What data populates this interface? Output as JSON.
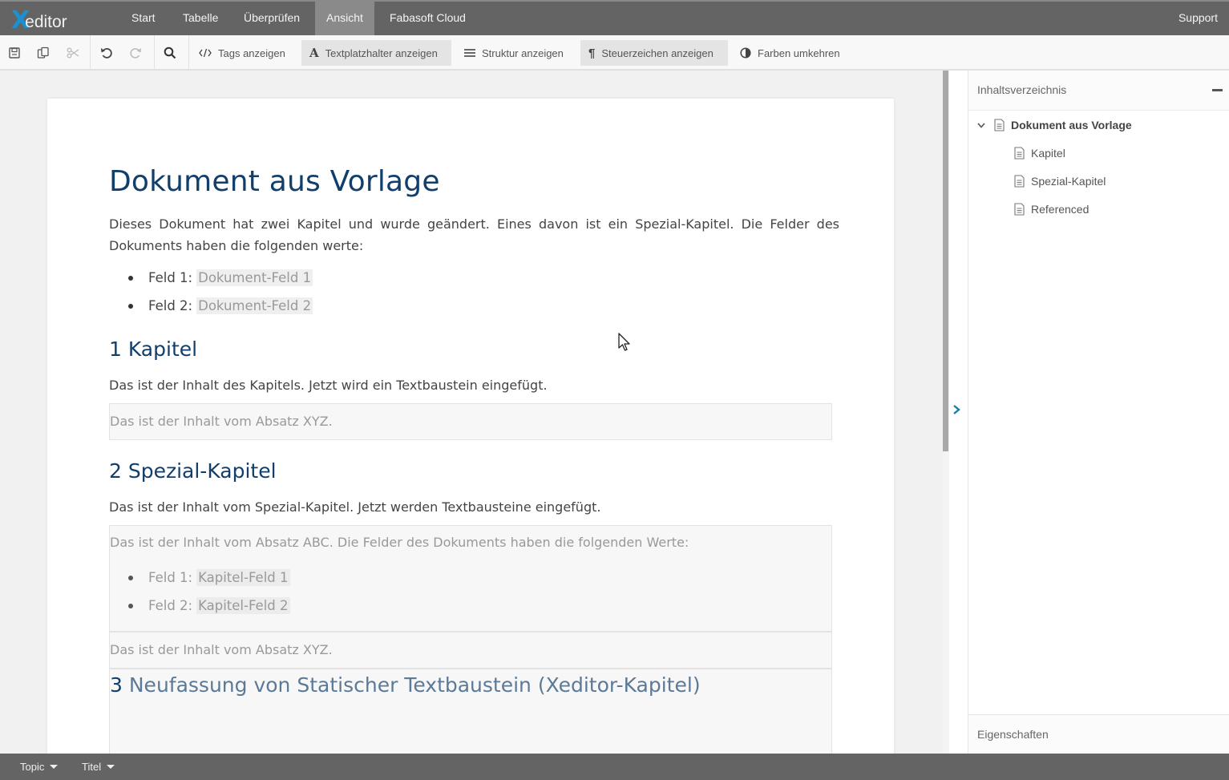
{
  "app": {
    "logo_x": "X",
    "logo_rest": "editor",
    "menu": [
      {
        "label": "Start",
        "active": false
      },
      {
        "label": "Tabelle",
        "active": false
      },
      {
        "label": "Überprüfen",
        "active": false
      },
      {
        "label": "Ansicht",
        "active": true
      },
      {
        "label": "Fabasoft Cloud",
        "active": false
      }
    ],
    "support_label": "Support"
  },
  "toolbar": {
    "icons": [
      "save-icon",
      "copy-icon",
      "cut-icon",
      "undo-icon",
      "redo-icon",
      "search-icon"
    ],
    "buttons": [
      {
        "label": "Tags anzeigen",
        "icon": "code-tags-icon",
        "active": false
      },
      {
        "label": "Textplatzhalter anzeigen",
        "icon": "text-placeholder-icon",
        "active": true
      },
      {
        "label": "Struktur anzeigen",
        "icon": "structure-list-icon",
        "active": false
      },
      {
        "label": "Steuerzeichen anzeigen",
        "icon": "pilcrow-icon",
        "active": true
      },
      {
        "label": "Farben umkehren",
        "icon": "invert-colors-icon",
        "active": false
      }
    ]
  },
  "document": {
    "title": "Dokument aus Vorlage",
    "intro": "Dieses Dokument hat zwei Kapitel und wurde geändert. Eines davon ist ein Spezial-Kapitel. Die Felder des Dokuments haben die folgenden werte:",
    "fields": [
      {
        "label": "Feld 1:",
        "value": "Dokument-Feld 1"
      },
      {
        "label": "Feld 2:",
        "value": "Dokument-Feld 2"
      }
    ],
    "chapter1": {
      "heading": "1 Kapitel",
      "text": "Das ist der Inhalt des Kapitels. Jetzt wird ein Textbaustein eingefügt.",
      "block_text": "Das ist der Inhalt vom Absatz XYZ."
    },
    "chapter2": {
      "heading": "2 Spezial-Kapitel",
      "text": "Das ist der Inhalt vom Spezial-Kapitel. Jetzt werden Textbausteine eingefügt.",
      "block_abc_text": "Das ist der Inhalt vom Absatz ABC. Die Felder des  Dokuments haben die folgenden Werte:",
      "block_fields": [
        {
          "label": "Feld 1:",
          "value": "Kapitel-Feld 1"
        },
        {
          "label": "Feld 2:",
          "value": "Kapitel-Feld 2"
        }
      ],
      "block_xyz_text": "Das ist der Inhalt vom Absatz XYZ."
    },
    "chapter3": {
      "number": "3",
      "heading": "Neufassung von Statischer Textbaustein (Xeditor-Kapitel)"
    }
  },
  "side_panel": {
    "toc_title": "Inhaltsverzeichnis",
    "toc_root": "Dokument aus Vorlage",
    "toc_children": [
      "Kapitel",
      "Spezial-Kapitel",
      "Referenced"
    ],
    "properties_title": "Eigenschaften"
  },
  "statusbar": {
    "dropdowns": [
      {
        "label": "Topic"
      },
      {
        "label": "Titel"
      }
    ]
  },
  "colors": {
    "menubar": "#646464",
    "heading": "#123e6b",
    "accent": "#1e8fd0",
    "collapse_arrow": "#1a7fa6"
  }
}
